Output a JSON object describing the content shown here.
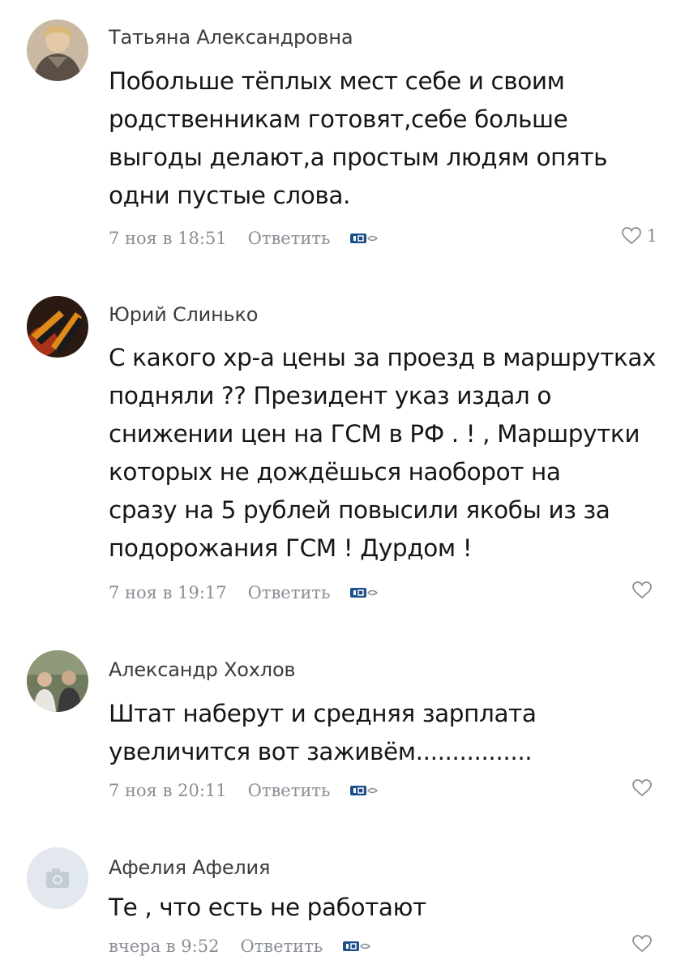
{
  "comments": [
    {
      "author": "Татьяна Александровна",
      "text": "Побольше тёплых мест себе и своим\nродственникам готовят,себе больше\nвыгоды делают,а простым людям опять\nодни пустые слова.",
      "date": "7 ноя в 18:51",
      "reply_label": "Ответить",
      "like_count": "1"
    },
    {
      "author": "Юрий Слинько",
      "text": "С какого хр-а цены за проезд в маршрутках\nподняли ?? Президент указ издал о\nснижении цен на ГСМ в РФ . ! , Маршрутки\nкоторых не дождёшься наоборот на\nсразу на 5 рублей повысили якобы из за\nподорожания ГСМ ! Дурдом !",
      "date": "7 ноя в 19:17",
      "reply_label": "Ответить",
      "like_count": ""
    },
    {
      "author": "Александр Хохлов",
      "text": "Штат наберут и средняя зарплата\nувеличится вот заживём................",
      "date": "7 ноя в 20:11",
      "reply_label": "Ответить",
      "like_count": ""
    },
    {
      "author": "Афелия Афелия",
      "text": "Те , что есть не работают",
      "date": "вчера в 9:52",
      "reply_label": "Ответить",
      "like_count": ""
    }
  ],
  "icons": {
    "like": "heart-outline-icon",
    "badge": "tv-channel-badge-icon",
    "placeholder_avatar": "camera-icon"
  },
  "colors": {
    "meta_gray": "#8a8f96",
    "badge_blue": "#1d4f8a",
    "placeholder_avatar_bg": "#e3e8ee"
  }
}
